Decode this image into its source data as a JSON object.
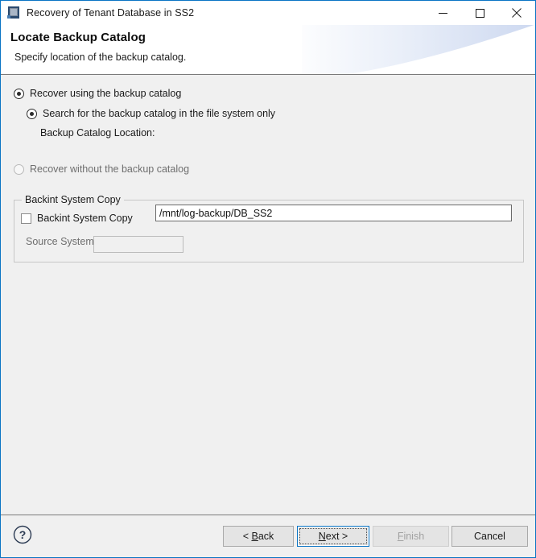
{
  "window": {
    "title": "Recovery of Tenant Database in SS2",
    "icon": "database-window-icon",
    "accent_color": "#0a74c4",
    "body_color": "#f0f0f0"
  },
  "titlebar_buttons": {
    "minimize": "minimize-icon",
    "maximize": "maximize-icon",
    "close": "close-icon"
  },
  "header": {
    "title": "Locate Backup Catalog",
    "subtitle": "Specify location of the backup catalog."
  },
  "main": {
    "recover_with_catalog": {
      "label": "Recover using the backup catalog",
      "checked": true,
      "enabled": true
    },
    "search_file_system_only": {
      "label": "Search for the backup catalog in the file system only",
      "checked": true,
      "enabled": true
    },
    "catalog_location": {
      "label": "Backup Catalog Location:",
      "value": "/mnt/log-backup/DB_SS2",
      "placeholder": ""
    },
    "recover_without_catalog": {
      "label": "Recover without the backup catalog",
      "checked": false,
      "enabled": false
    },
    "backint_group": {
      "title": "Backint System Copy",
      "checkbox_label": "Backint System Copy",
      "checkbox_checked": false,
      "source_system_label": "Source System:",
      "source_system_value": "",
      "source_system_enabled": false
    }
  },
  "footer": {
    "help_icon": "help-question-icon",
    "buttons": [
      {
        "key": "back",
        "label": "< Back",
        "mnemonic": "B",
        "enabled": true,
        "focused": false
      },
      {
        "key": "next",
        "label": "Next >",
        "mnemonic": "N",
        "enabled": true,
        "focused": true
      },
      {
        "key": "finish",
        "label": "Finish",
        "mnemonic": "F",
        "enabled": false,
        "focused": false
      },
      {
        "key": "cancel",
        "label": "Cancel",
        "mnemonic": "",
        "enabled": true,
        "focused": false
      }
    ]
  }
}
